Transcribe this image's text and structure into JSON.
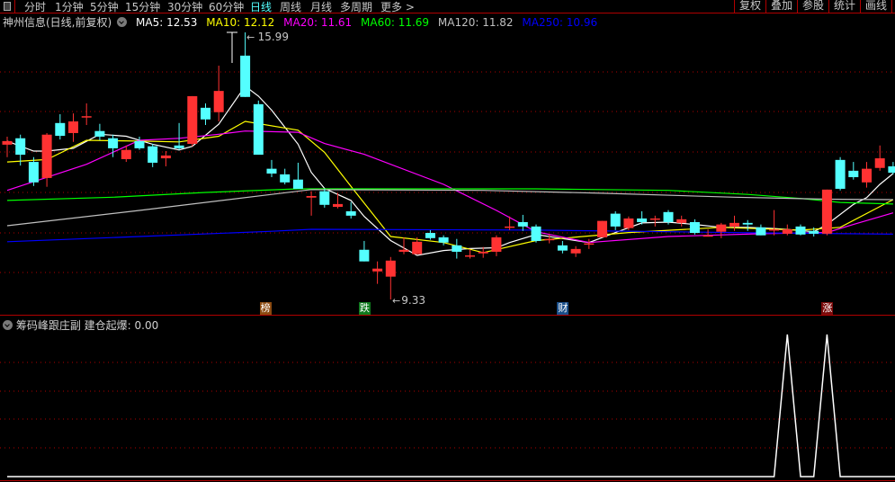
{
  "toolbar": {
    "periods": [
      {
        "label": "分时",
        "active": false
      },
      {
        "label": "1分钟",
        "active": false
      },
      {
        "label": "5分钟",
        "active": false
      },
      {
        "label": "15分钟",
        "active": false
      },
      {
        "label": "30分钟",
        "active": false
      },
      {
        "label": "60分钟",
        "active": false
      },
      {
        "label": "日线",
        "active": true
      },
      {
        "label": "周线",
        "active": false
      },
      {
        "label": "月线",
        "active": false
      },
      {
        "label": "多周期",
        "active": false
      },
      {
        "label": "更多 >",
        "active": false
      }
    ],
    "right_buttons": [
      "复权",
      "叠加",
      "参股",
      "统计",
      "画线"
    ]
  },
  "info": {
    "title": "神州信息(日线,前复权)",
    "ma5": "MA5: 12.53",
    "ma10": "MA10: 12.12",
    "ma20": "MA20: 11.61",
    "ma60": "MA60: 11.69",
    "ma120": "MA120: 11.82",
    "ma250": "MA250: 10.96"
  },
  "colors": {
    "up": "#ff3232",
    "down": "#54ffff",
    "ma5": "#ffffff",
    "ma10": "#ffff00",
    "ma20": "#ff00ff",
    "ma60": "#00ff00",
    "ma120": "#c0c0c0",
    "ma250": "#0000ff",
    "grid": "#b00000"
  },
  "indicator": {
    "title": "筹码峰跟庄副",
    "label": "建仓起爆: 0.00"
  },
  "chart_data": {
    "type": "candlestick",
    "title": "神州信息(日线,前复权)",
    "price_range": [
      9.0,
      16.2
    ],
    "annotations": {
      "high": "15.99",
      "low": "9.33"
    },
    "signals": [
      {
        "index": 19.5,
        "label": "榜",
        "color": "#8b4a10"
      },
      {
        "index": 27,
        "label": "跌",
        "color": "#0f7a1e"
      },
      {
        "index": 42,
        "label": "财",
        "color": "#1a4f8a"
      },
      {
        "index": 62,
        "label": "涨",
        "color": "#7a0a0a"
      }
    ],
    "candles_ochl": [
      [
        13.19,
        13.28,
        13.39,
        12.88
      ],
      [
        13.35,
        12.94,
        13.44,
        12.67
      ],
      [
        12.76,
        12.25,
        12.88,
        12.16
      ],
      [
        12.36,
        13.44,
        13.48,
        12.14
      ],
      [
        13.73,
        13.41,
        13.95,
        13.32
      ],
      [
        13.48,
        13.77,
        13.97,
        13.26
      ],
      [
        13.88,
        13.9,
        14.22,
        13.68
      ],
      [
        13.53,
        13.39,
        13.71,
        13.3
      ],
      [
        13.35,
        13.1,
        13.44,
        12.88
      ],
      [
        12.83,
        13.06,
        13.17,
        12.76
      ],
      [
        13.28,
        13.1,
        13.39,
        13.06
      ],
      [
        13.15,
        12.74,
        13.21,
        12.63
      ],
      [
        12.85,
        12.92,
        13.03,
        12.65
      ],
      [
        13.17,
        13.1,
        13.73,
        13.06
      ],
      [
        13.21,
        14.4,
        14.4,
        13.15
      ],
      [
        14.11,
        13.82,
        14.22,
        13.68
      ],
      [
        14.0,
        14.53,
        15.16,
        13.77
      ],
      null,
      [
        15.41,
        14.38,
        15.99,
        14.38
      ],
      [
        14.2,
        12.94,
        14.29,
        12.94
      ],
      [
        12.59,
        12.47,
        12.81,
        12.38
      ],
      [
        12.45,
        12.25,
        12.59,
        12.2
      ],
      [
        12.32,
        12.09,
        12.74,
        12.09
      ],
      [
        11.87,
        11.91,
        12.03,
        11.42
      ],
      [
        12.03,
        11.69,
        12.09,
        11.62
      ],
      [
        11.64,
        11.71,
        11.98,
        11.6
      ],
      [
        11.53,
        11.42,
        11.76,
        11.35
      ],
      [
        10.57,
        10.28,
        10.79,
        10.28
      ],
      [
        10.03,
        10.1,
        10.28,
        9.72
      ],
      [
        9.9,
        10.3,
        10.39,
        9.33
      ],
      [
        10.52,
        10.57,
        10.88,
        10.46
      ],
      [
        10.46,
        10.77,
        10.88,
        10.46
      ],
      [
        10.99,
        10.86,
        11.06,
        10.82
      ],
      [
        10.88,
        10.75,
        10.93,
        10.68
      ],
      [
        10.68,
        10.52,
        10.84,
        10.35
      ],
      [
        10.41,
        10.43,
        10.59,
        10.35
      ],
      [
        10.48,
        10.52,
        10.64,
        10.37
      ],
      [
        10.52,
        10.88,
        10.93,
        10.41
      ],
      [
        11.13,
        11.15,
        11.4,
        11.06
      ],
      [
        11.26,
        11.15,
        11.44,
        11.04
      ],
      [
        11.15,
        10.79,
        11.2,
        10.75
      ],
      [
        10.82,
        10.84,
        10.95,
        10.73
      ],
      [
        10.68,
        10.55,
        10.79,
        10.48
      ],
      [
        10.48,
        10.59,
        10.66,
        10.39
      ],
      [
        10.7,
        10.73,
        10.84,
        10.59
      ],
      [
        10.88,
        11.29,
        11.29,
        10.88
      ],
      [
        11.47,
        11.15,
        11.53,
        11.06
      ],
      [
        11.11,
        11.35,
        11.4,
        11.06
      ],
      [
        11.35,
        11.26,
        11.53,
        11.2
      ],
      [
        11.33,
        11.35,
        11.42,
        11.15
      ],
      [
        11.51,
        11.26,
        11.56,
        11.2
      ],
      [
        11.24,
        11.33,
        11.42,
        11.15
      ],
      [
        11.26,
        10.99,
        11.33,
        10.95
      ],
      [
        10.9,
        10.93,
        11.08,
        10.9
      ],
      [
        11.02,
        11.2,
        11.24,
        10.86
      ],
      [
        11.15,
        11.24,
        11.42,
        11.04
      ],
      [
        11.24,
        11.2,
        11.31,
        11.04
      ],
      [
        11.13,
        10.93,
        11.2,
        10.93
      ],
      [
        11.06,
        11.08,
        11.56,
        10.93
      ],
      [
        10.97,
        11.08,
        11.2,
        10.93
      ],
      [
        11.15,
        10.95,
        11.2,
        10.93
      ],
      [
        11.04,
        10.97,
        11.13,
        10.9
      ],
      [
        10.97,
        12.07,
        12.07,
        10.93
      ],
      [
        12.81,
        12.09,
        12.88,
        12.05
      ],
      [
        12.54,
        12.38,
        12.76,
        12.32
      ],
      [
        12.25,
        12.59,
        12.76,
        12.12
      ],
      [
        12.61,
        12.85,
        13.17,
        12.54
      ],
      [
        12.65,
        12.49,
        12.76,
        12.45
      ]
    ],
    "ma_lines": {
      "ma5": [
        [
          0,
          13.28
        ],
        [
          2,
          13.03
        ],
        [
          3,
          13.03
        ],
        [
          5,
          13.1
        ],
        [
          7,
          13.45
        ],
        [
          9,
          13.4
        ],
        [
          11,
          13.2
        ],
        [
          13,
          13.06
        ],
        [
          14,
          13.15
        ],
        [
          16,
          13.7
        ],
        [
          18,
          14.65
        ],
        [
          19,
          14.4
        ],
        [
          20,
          14.05
        ],
        [
          22,
          13.2
        ],
        [
          23,
          12.5
        ],
        [
          24,
          12.1
        ],
        [
          26,
          11.8
        ],
        [
          27,
          11.4
        ],
        [
          29,
          10.8
        ],
        [
          31,
          10.43
        ],
        [
          33,
          10.55
        ],
        [
          35,
          10.6
        ],
        [
          37,
          10.62
        ],
        [
          38,
          10.75
        ],
        [
          40,
          10.95
        ],
        [
          42,
          10.85
        ],
        [
          44,
          10.75
        ],
        [
          46,
          11.0
        ],
        [
          48,
          11.24
        ],
        [
          50,
          11.26
        ],
        [
          52,
          11.2
        ],
        [
          54,
          11.13
        ],
        [
          56,
          11.13
        ],
        [
          58,
          11.1
        ],
        [
          60,
          11.05
        ],
        [
          61,
          11.02
        ],
        [
          62,
          11.2
        ],
        [
          64,
          11.7
        ],
        [
          65,
          11.87
        ],
        [
          66,
          12.2
        ],
        [
          67,
          12.47
        ]
      ],
      "ma10": [
        [
          0,
          12.76
        ],
        [
          3,
          12.82
        ],
        [
          6,
          13.3
        ],
        [
          10,
          13.28
        ],
        [
          13,
          13.26
        ],
        [
          16,
          13.4
        ],
        [
          18,
          13.77
        ],
        [
          22,
          13.55
        ],
        [
          24,
          13.0
        ],
        [
          26,
          12.15
        ],
        [
          29,
          10.9
        ],
        [
          33,
          10.75
        ],
        [
          36,
          10.5
        ],
        [
          40,
          10.8
        ],
        [
          47,
          11.0
        ],
        [
          54,
          11.13
        ],
        [
          60,
          11.06
        ],
        [
          63,
          11.13
        ],
        [
          67,
          11.82
        ]
      ],
      "ma20": [
        [
          0,
          12.05
        ],
        [
          6,
          12.7
        ],
        [
          10,
          13.3
        ],
        [
          13,
          13.35
        ],
        [
          16,
          13.45
        ],
        [
          18,
          13.53
        ],
        [
          22,
          13.5
        ],
        [
          24,
          13.22
        ],
        [
          27,
          12.95
        ],
        [
          33,
          12.2
        ],
        [
          37,
          11.55
        ],
        [
          40,
          11.02
        ],
        [
          44,
          10.75
        ],
        [
          50,
          10.9
        ],
        [
          57,
          10.97
        ],
        [
          62,
          11.0
        ],
        [
          64,
          11.2
        ],
        [
          67,
          11.49
        ]
      ],
      "ma60": [
        [
          0,
          11.8
        ],
        [
          8,
          11.88
        ],
        [
          15,
          12.0
        ],
        [
          22,
          12.09
        ],
        [
          40,
          12.09
        ],
        [
          50,
          12.05
        ],
        [
          56,
          11.95
        ],
        [
          60,
          11.85
        ],
        [
          63,
          11.75
        ],
        [
          67,
          11.71
        ]
      ],
      "ma120": [
        [
          0,
          11.17
        ],
        [
          10,
          11.55
        ],
        [
          20,
          11.95
        ],
        [
          23,
          12.07
        ],
        [
          36,
          12.05
        ],
        [
          45,
          11.98
        ],
        [
          55,
          11.88
        ],
        [
          62,
          11.83
        ],
        [
          67,
          11.82
        ]
      ],
      "ma250": [
        [
          0,
          10.77
        ],
        [
          10,
          10.9
        ],
        [
          20,
          11.03
        ],
        [
          23,
          11.08
        ],
        [
          40,
          11.06
        ],
        [
          55,
          11.0
        ],
        [
          67,
          10.96
        ]
      ]
    },
    "indicator_series": {
      "name": "建仓起爆",
      "range": [
        0,
        1
      ],
      "points": [
        [
          0,
          0
        ],
        [
          58,
          0
        ],
        [
          59,
          1
        ],
        [
          60,
          0
        ],
        [
          61,
          0
        ],
        [
          62,
          1
        ],
        [
          63,
          0
        ],
        [
          67,
          0
        ]
      ]
    }
  }
}
